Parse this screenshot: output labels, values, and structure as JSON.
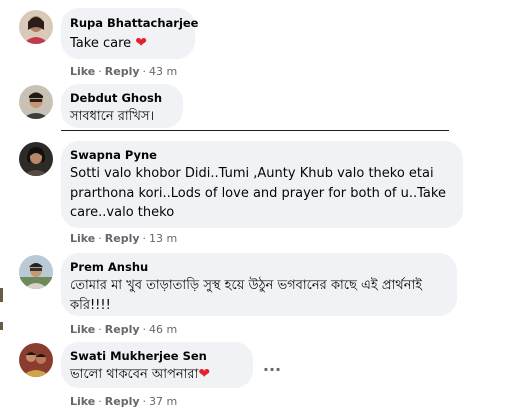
{
  "action_like": "Like",
  "action_reply": "Reply",
  "separator": "·",
  "more_label": "···",
  "colors": {
    "bubble_bg": "#f0f2f5",
    "text": "#050505",
    "meta": "#65676b",
    "heart": "#e4212a"
  },
  "comments": [
    {
      "author": "Rupa Bhattacharjee",
      "text": "Take care",
      "icon": "heart-icon",
      "time": "43 m"
    },
    {
      "author": "Debdut Ghosh",
      "text": "সাবধানে রাখিস।",
      "icon": "",
      "time": ""
    },
    {
      "author": "Swapna Pyne",
      "text": "Sotti valo khobor Didi..Tumi ,Aunty Khub valo theko etai prarthona kori..Lods of love and prayer for both of u..Take care..valo theko",
      "icon": "",
      "time": "13 m"
    },
    {
      "author": "Prem Anshu",
      "text": "তোমার মা খুব তাড়াতাড়ি সুস্থ হয়ে উঠুন ভগবানের কাছে এই প্রার্থনাই করি!!!!",
      "icon": "",
      "time": "46 m"
    },
    {
      "author": "Swati Mukherjee Sen",
      "text": "ভালো থাকবেন আপনারা",
      "icon": "heart-icon",
      "time": "37 m"
    }
  ]
}
